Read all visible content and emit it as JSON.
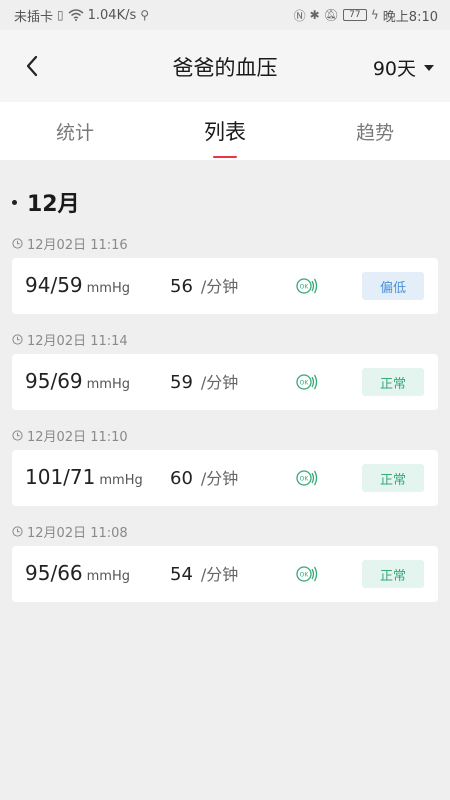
{
  "status_bar": {
    "carrier": "未插卡",
    "speed": "1.04K/s",
    "battery": "77",
    "time": "晚上8:10"
  },
  "header": {
    "title": "爸爸的血压",
    "range": "90天"
  },
  "tabs": [
    "统计",
    "列表",
    "趋势"
  ],
  "active_tab": "列表",
  "month": "12月",
  "records": [
    {
      "time": "12月02日 11:16",
      "bp": "94/59",
      "bp_unit": "mmHg",
      "pulse": "56",
      "pulse_unit": "/分钟",
      "status": "偏低"
    },
    {
      "time": "12月02日 11:14",
      "bp": "95/69",
      "bp_unit": "mmHg",
      "pulse": "59",
      "pulse_unit": "/分钟",
      "status": "正常"
    },
    {
      "time": "12月02日 11:10",
      "bp": "101/71",
      "bp_unit": "mmHg",
      "pulse": "60",
      "pulse_unit": "/分钟",
      "status": "正常"
    },
    {
      "time": "12月02日 11:08",
      "bp": "95/66",
      "bp_unit": "mmHg",
      "pulse": "54",
      "pulse_unit": "/分钟",
      "status": "正常"
    }
  ],
  "colors": {
    "accent": "#e8383d",
    "low": "#4a90d9",
    "normal": "#35a97a"
  }
}
